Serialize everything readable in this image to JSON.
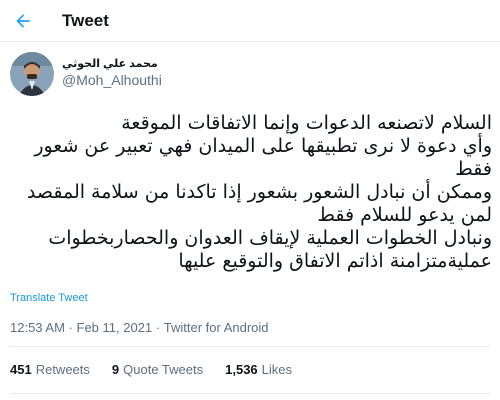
{
  "header": {
    "title": "Tweet",
    "back_icon": "arrow-left-icon",
    "accent": "#1da1f2"
  },
  "author": {
    "display_name": "محمد علي الحوثي",
    "handle": "@Moh_Alhouthi"
  },
  "tweet": {
    "lines": [
      "السلام لاتصنعه الدعوات وإنما الاتفاقات الموقعة",
      "وأي دعوة لا نرى تطبيقها على الميدان فهي تعبير عن شعور فقط",
      "وممكن أن نبادل الشعور بشعور إذا تاكدنا من سلامة المقصد لمن يدعو للسلام فقط",
      "ونبادل الخطوات العملية لإيقاف العدوان والحصاربخطوات عمليةمتزامنة اذاتم الاتفاق والتوقيع عليها"
    ]
  },
  "translate_label": "Translate Tweet",
  "meta": {
    "time": "12:53 AM",
    "date": "Feb 11, 2021",
    "source": "Twitter for Android",
    "separator": "·"
  },
  "stats": {
    "retweets_count": "451",
    "retweets_label": "Retweets",
    "quotes_count": "9",
    "quotes_label": "Quote Tweets",
    "likes_count": "1,536",
    "likes_label": "Likes"
  }
}
